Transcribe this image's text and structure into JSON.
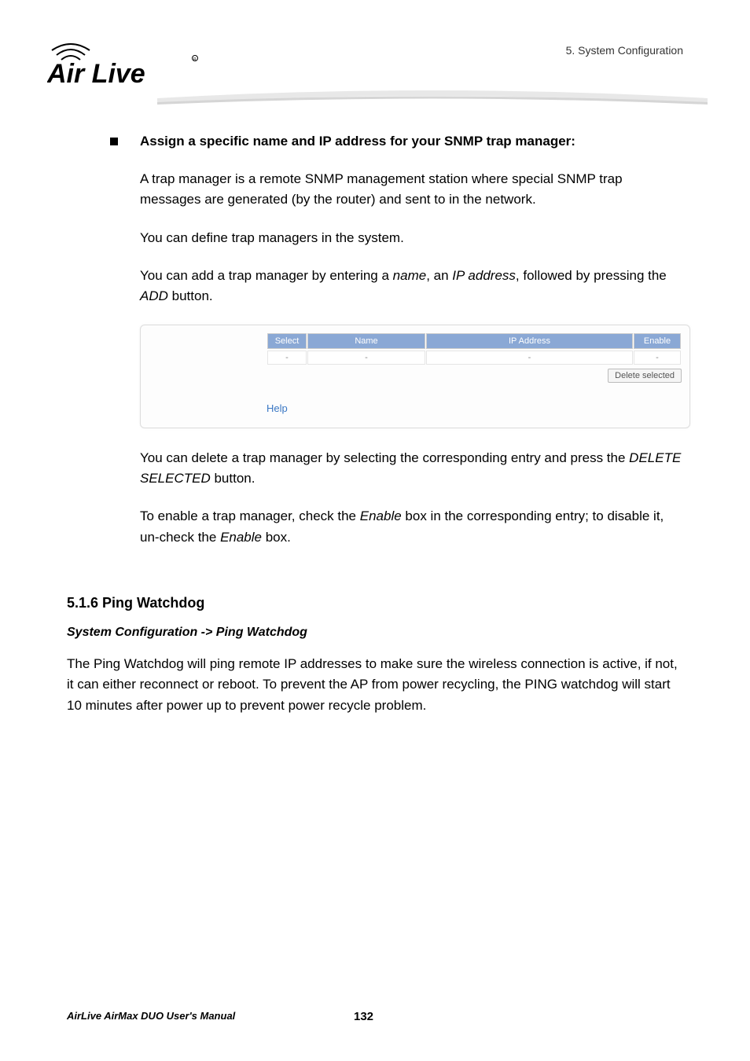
{
  "header": {
    "chapter": "5.  System  Configuration"
  },
  "logo": {
    "brand_text": "Air Live"
  },
  "section_main": {
    "bullet_title": "Assign a specific name and IP address for your SNMP trap manager:",
    "para1": "A trap manager is a remote SNMP management station where special SNMP trap messages are generated (by the router) and sent to in the network.",
    "para2": "You can define trap managers in the system.",
    "para3_pre": "You can add a trap manager by entering a ",
    "para3_i1": "name",
    "para3_mid1": ", an ",
    "para3_i2": "IP address",
    "para3_mid2": ", followed by pressing the ",
    "para3_i3": "ADD",
    "para3_post": " button.",
    "table": {
      "headers": [
        "Select",
        "Name",
        "IP Address",
        "Enable"
      ],
      "row": [
        "-",
        "-",
        "-",
        "-"
      ],
      "delete_btn": "Delete selected",
      "help_link": "Help"
    },
    "para4_pre": "You can delete a trap manager by selecting the corresponding entry and press the ",
    "para4_i1": "DELETE SELECTED",
    "para4_post": " button.",
    "para5_pre": "To enable a trap manager, check the ",
    "para5_i1": "Enable",
    "para5_mid": " box in the corresponding entry; to disable it, un-check the ",
    "para5_i2": "Enable",
    "para5_post": " box."
  },
  "section_sub": {
    "heading": "5.1.6 Ping Watchdog",
    "breadcrumb": "System Configuration -> Ping Watchdog",
    "body": "The Ping Watchdog will ping remote IP addresses to make sure the wireless connection is active, if not, it can either reconnect or reboot. To prevent the AP from power recycling, the PING watchdog will start 10 minutes after power up to prevent power recycle problem."
  },
  "footer": {
    "manual_title": "AirLive AirMax DUO User's Manual",
    "page_number": "132"
  }
}
